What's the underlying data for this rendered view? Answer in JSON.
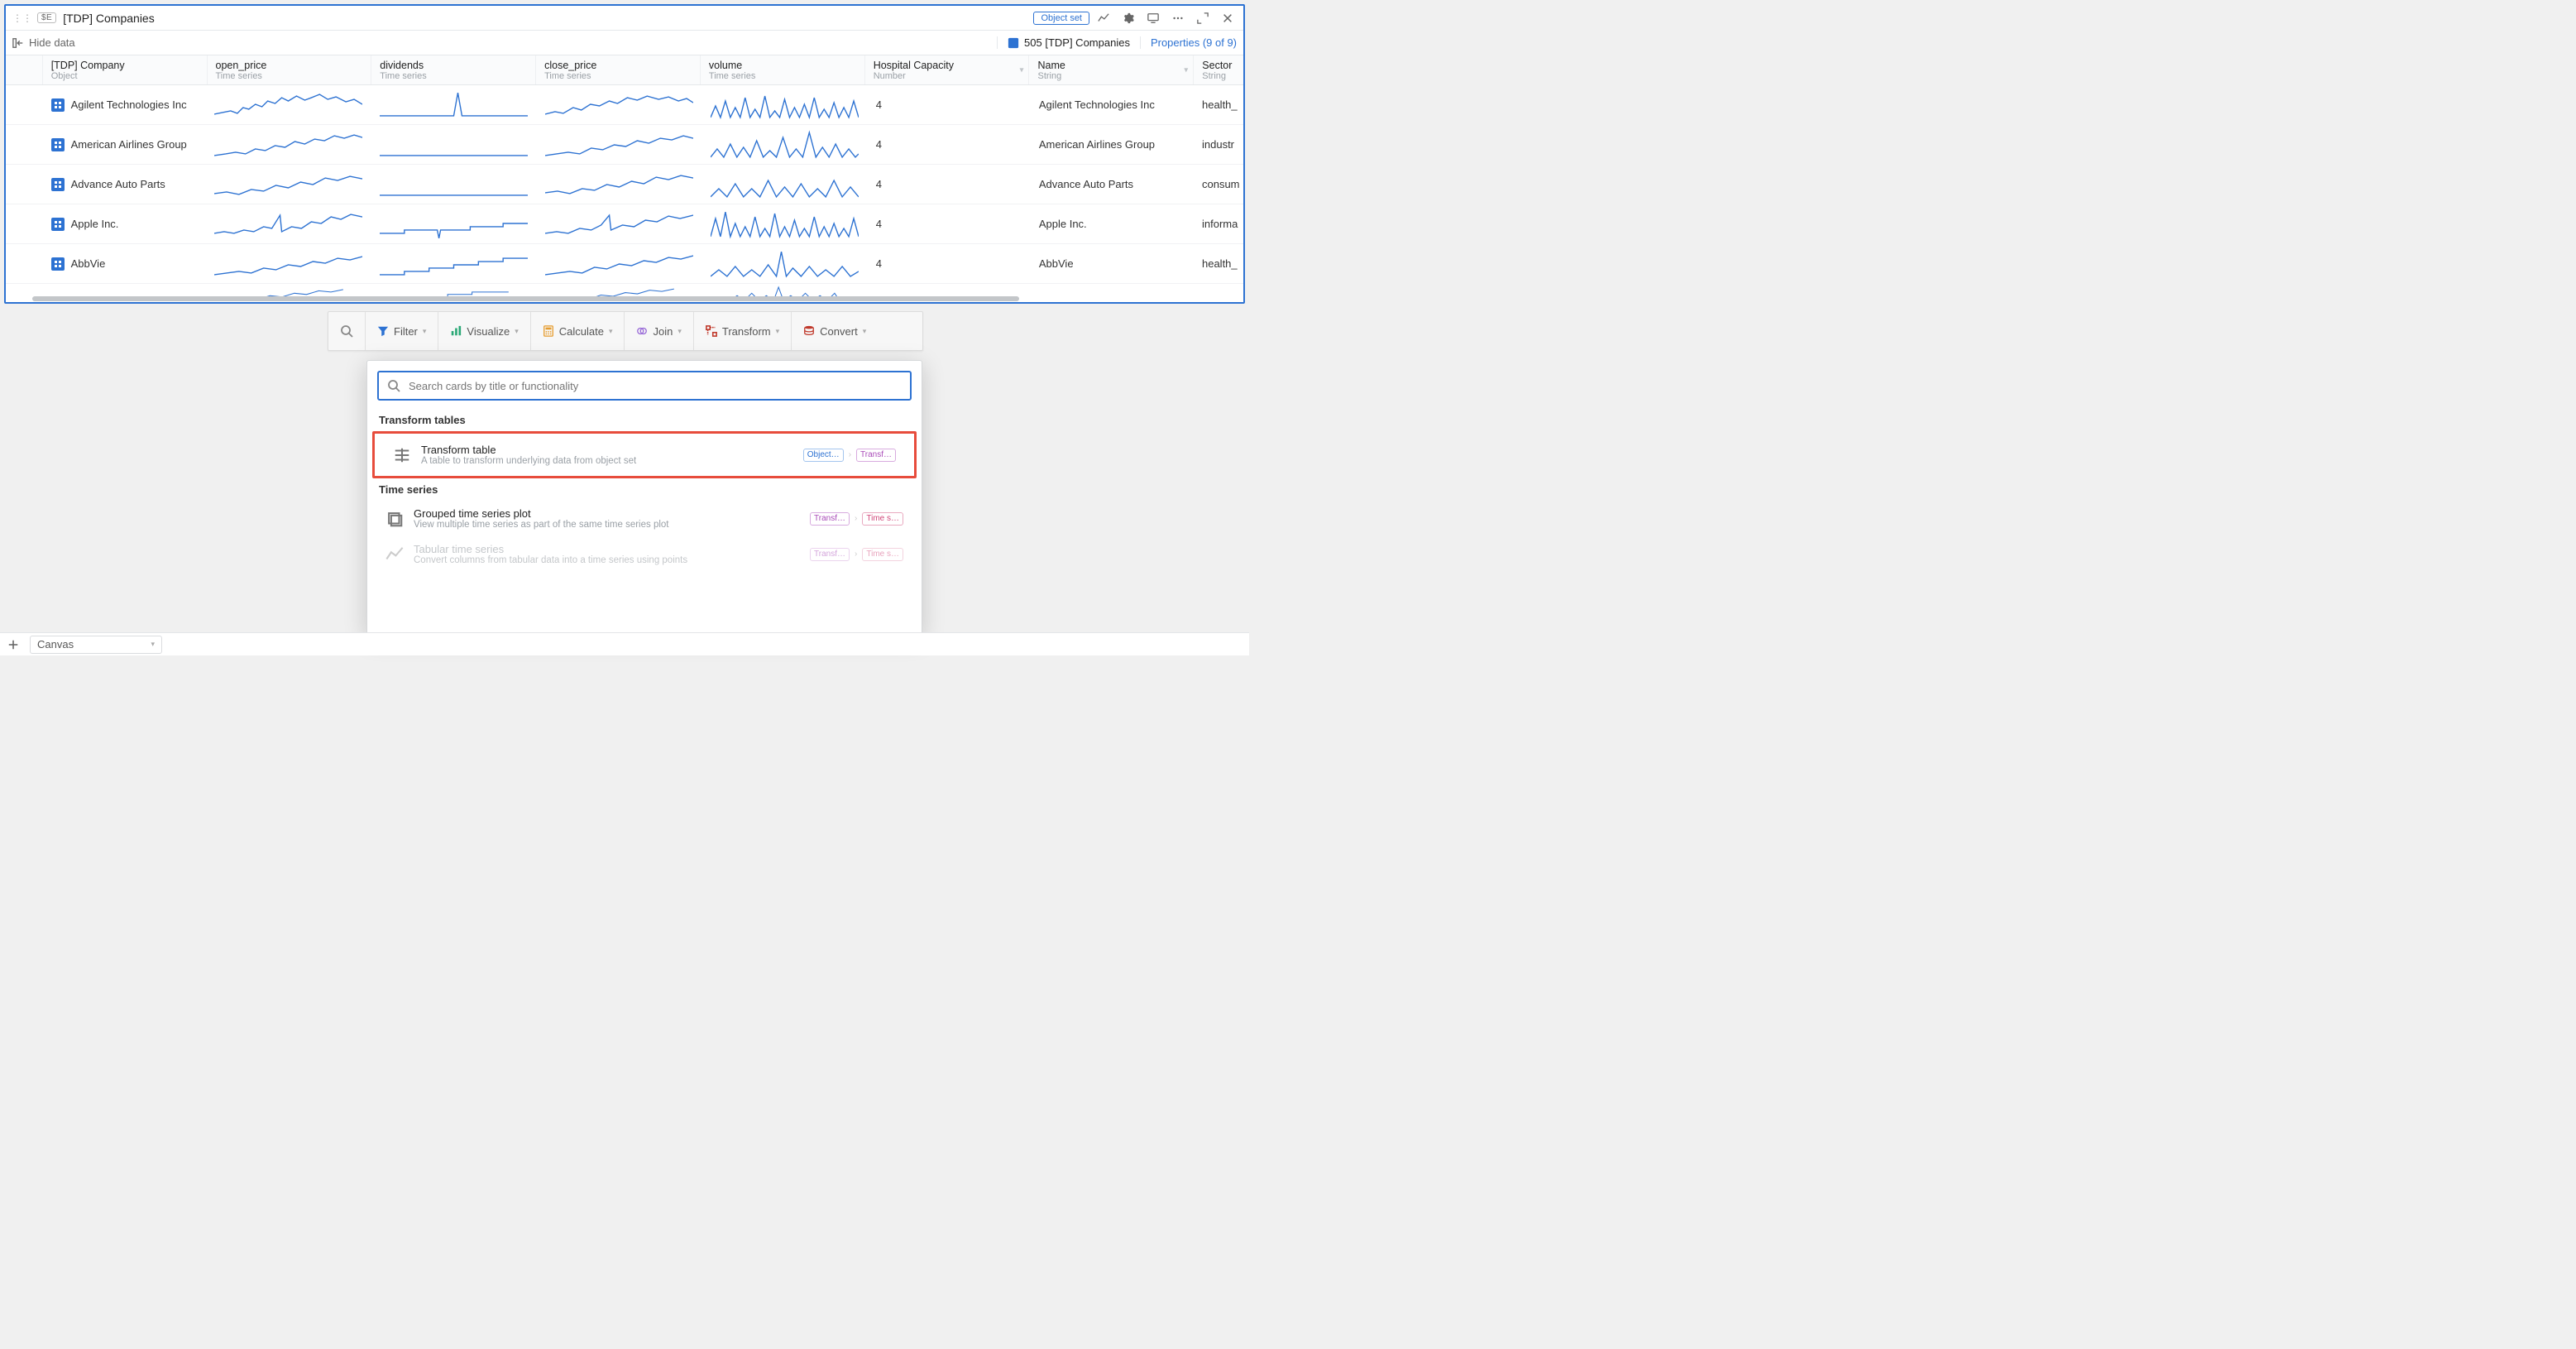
{
  "panel": {
    "badge": "$E",
    "title": "[TDP] Companies",
    "objectset_btn": "Object set",
    "hide_data": "Hide data",
    "count_text": "505 [TDP] Companies",
    "properties_link": "Properties (9 of 9)"
  },
  "columns": {
    "company": {
      "title": "[TDP] Company",
      "sub": "Object"
    },
    "open": {
      "title": "open_price",
      "sub": "Time series"
    },
    "div": {
      "title": "dividends",
      "sub": "Time series"
    },
    "close": {
      "title": "close_price",
      "sub": "Time series"
    },
    "vol": {
      "title": "volume",
      "sub": "Time series"
    },
    "hosp": {
      "title": "Hospital Capacity",
      "sub": "Number"
    },
    "name": {
      "title": "Name",
      "sub": "String"
    },
    "sector": {
      "title": "Sector",
      "sub": "String"
    }
  },
  "rows": [
    {
      "company": "Agilent Technologies Inc",
      "hosp": "4",
      "name": "Agilent Technologies Inc",
      "sector": "health_"
    },
    {
      "company": "American Airlines Group",
      "hosp": "4",
      "name": "American Airlines Group",
      "sector": "industr"
    },
    {
      "company": "Advance Auto Parts",
      "hosp": "4",
      "name": "Advance Auto Parts",
      "sector": "consum"
    },
    {
      "company": "Apple Inc.",
      "hosp": "4",
      "name": "Apple Inc.",
      "sector": "informa"
    },
    {
      "company": "AbbVie",
      "hosp": "4",
      "name": "AbbVie",
      "sector": "health_"
    }
  ],
  "actions": {
    "filter": "Filter",
    "visualize": "Visualize",
    "calculate": "Calculate",
    "join": "Join",
    "transform": "Transform",
    "convert": "Convert"
  },
  "popover": {
    "placeholder": "Search cards by title or functionality",
    "section_tables": "Transform tables",
    "section_ts": "Time series",
    "cards": {
      "transform_table": {
        "title": "Transform table",
        "desc": "A table to transform underlying data from object set",
        "tag1": "Object…",
        "tag2": "Transf…"
      },
      "grouped_ts": {
        "title": "Grouped time series plot",
        "desc": "View multiple time series as part of the same time series plot",
        "tag1": "Transf…",
        "tag2": "Time s…"
      },
      "tabular_ts": {
        "title": "Tabular time series",
        "desc": "Convert columns from tabular data into a time series using points",
        "tag1": "Transf…",
        "tag2": "Time s…"
      }
    }
  },
  "bottom": {
    "canvas": "Canvas"
  }
}
